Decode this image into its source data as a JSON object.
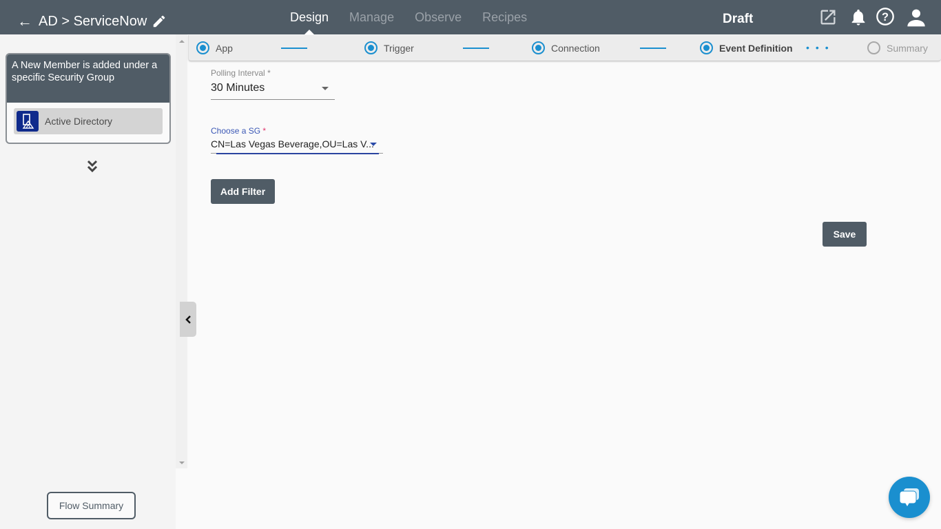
{
  "header": {
    "title": "AD > ServiceNow",
    "status": "Draft",
    "nav_tabs": [
      {
        "label": "Design",
        "active": true
      },
      {
        "label": "Manage",
        "active": false
      },
      {
        "label": "Observe",
        "active": false
      },
      {
        "label": "Recipes",
        "active": false
      }
    ],
    "icons": [
      "back-arrow-icon",
      "pencil-icon",
      "external-link-icon",
      "bell-icon",
      "help-icon",
      "user-icon"
    ]
  },
  "left_panel": {
    "card_title": "A New Member is added under a specific Security Group",
    "card_app": "Active Directory",
    "flow_summary_label": "Flow Summary"
  },
  "stepper": {
    "steps": [
      {
        "label": "App",
        "state": "complete"
      },
      {
        "label": "Trigger",
        "state": "complete"
      },
      {
        "label": "Connection",
        "state": "complete"
      },
      {
        "label": "Event Definition",
        "state": "current"
      },
      {
        "label": "Summary",
        "state": "pending"
      }
    ]
  },
  "form": {
    "polling_interval": {
      "label": "Polling Interval",
      "required_mark": "*",
      "value": "30 Minutes"
    },
    "choose_sg": {
      "label": "Choose a SG",
      "required_mark": "*",
      "value": "CN=Las Vegas Beverage,OU=Las V..."
    },
    "add_filter_label": "Add Filter",
    "save_label": "Save"
  },
  "colors": {
    "header_bg": "#505c66",
    "accent": "#1a8fcf",
    "focus": "#3a57b5",
    "required": "#e0356c"
  }
}
